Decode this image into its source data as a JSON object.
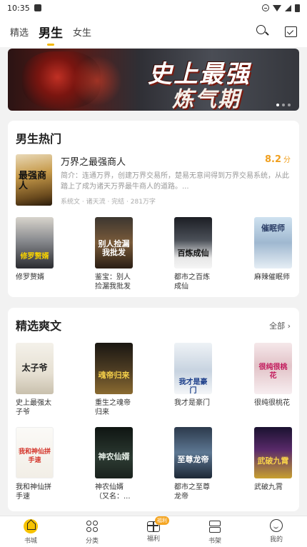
{
  "status_bar": {
    "time": "10:35"
  },
  "top_tabs": [
    {
      "label": "精选",
      "active": false
    },
    {
      "label": "男生",
      "active": true
    },
    {
      "label": "女生",
      "active": false
    }
  ],
  "banner": {
    "line1": "史上最强",
    "line2": "炼气期",
    "slides": 3,
    "current": 1
  },
  "hot_section": {
    "title": "男生热门",
    "featured": {
      "title": "万界之最强商人",
      "cover_text": "最强商人",
      "score": "8.2",
      "score_unit": "分",
      "desc": "简介：连通万界，创建万界交易所，楚易无意间得到万界交易系统，从此踏上了成为诸天万界最牛商人的道路。...",
      "meta": "系统文 · 诸天流 · 完结 · 281万字"
    },
    "books": [
      {
        "title": "修罗赘婿",
        "cover_text": "修罗赘婿"
      },
      {
        "title": "鉴宝：别人捡漏我批发",
        "cover_text": "别人捡漏我批发"
      },
      {
        "title": "都市之百炼成仙",
        "cover_text": "百炼成仙"
      },
      {
        "title": "麻辣催眠师",
        "cover_text": "催眠师"
      }
    ]
  },
  "picks_section": {
    "title": "精选爽文",
    "more": "全部",
    "books": [
      {
        "title": "史上最强太子爷",
        "cover_text": "太子爷"
      },
      {
        "title": "重生之魂帝归来",
        "cover_text": "魂帝归来"
      },
      {
        "title": "我才是豪门",
        "cover_text": "我才是豪门"
      },
      {
        "title": "很纯很桃花",
        "cover_text": "很纯很桃花"
      },
      {
        "title": "我和神仙拼手速",
        "cover_text": "我和神仙拼手速"
      },
      {
        "title": "神农仙婿（又名：...",
        "cover_text": "神农仙婿"
      },
      {
        "title": "都市之至尊龙帝",
        "cover_text": "至尊龙帝"
      },
      {
        "title": "武破九霄",
        "cover_text": "武破九霄"
      }
    ]
  },
  "bottom_nav": [
    {
      "label": "书城",
      "icon": "home-icon",
      "active": true
    },
    {
      "label": "分类",
      "icon": "category-icon"
    },
    {
      "label": "福利",
      "icon": "gift-icon",
      "badge": "福利"
    },
    {
      "label": "书架",
      "icon": "bookshelf-icon"
    },
    {
      "label": "我的",
      "icon": "profile-icon"
    }
  ],
  "colors": {
    "accent": "#f7c300",
    "score": "#f0a020"
  }
}
